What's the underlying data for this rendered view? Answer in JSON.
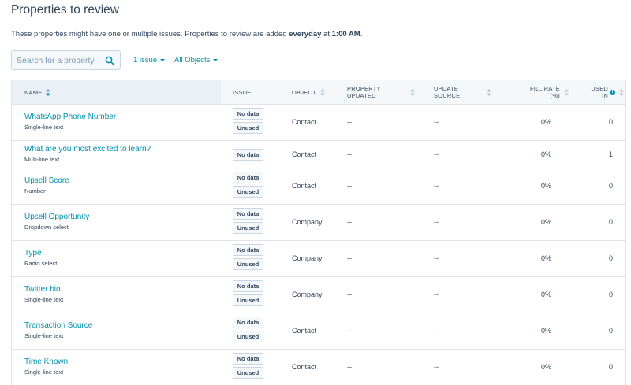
{
  "page": {
    "title": "Properties to review",
    "description_pre": "These properties might have one or multiple issues. Properties to review are added ",
    "description_bold1": "everyday",
    "description_mid": " at ",
    "description_bold2": "1:00 AM",
    "description_post": "."
  },
  "search": {
    "placeholder": "Search for a property",
    "value": ""
  },
  "filters": {
    "issue_label": "1 issue",
    "objects_label": "All Objects"
  },
  "table": {
    "headers": {
      "name": "NAME",
      "issue": "ISSUE",
      "object": "OBJECT",
      "property_updated_1": "PROPERTY",
      "property_updated_2": "UPDATED",
      "update_source_1": "UPDATE",
      "update_source_2": "SOURCE",
      "fill_rate_1": "FILL RATE",
      "fill_rate_2": "(%)",
      "used_in_1": "USED",
      "used_in_2": "IN"
    },
    "rows": [
      {
        "name": "WhatsApp Phone Number",
        "type": "Single-line text",
        "tags": [
          "No data",
          "Unused"
        ],
        "object": "Contact",
        "property_updated": "--",
        "update_source": "--",
        "fill_rate": "0%",
        "used_in": "0"
      },
      {
        "name": "What are you most excited to learn?",
        "type": "Multi-line text",
        "tags": [
          "No data"
        ],
        "object": "Contact",
        "property_updated": "--",
        "update_source": "--",
        "fill_rate": "0%",
        "used_in": "1"
      },
      {
        "name": "Upsell Score",
        "type": "Number",
        "tags": [
          "No data",
          "Unused"
        ],
        "object": "Contact",
        "property_updated": "--",
        "update_source": "--",
        "fill_rate": "0%",
        "used_in": "0"
      },
      {
        "name": "Upsell Opportunity",
        "type": "Dropdown select",
        "tags": [
          "No data",
          "Unused"
        ],
        "object": "Company",
        "property_updated": "--",
        "update_source": "--",
        "fill_rate": "0%",
        "used_in": "0"
      },
      {
        "name": "Type",
        "type": "Radio select",
        "tags": [
          "No data",
          "Unused"
        ],
        "object": "Company",
        "property_updated": "--",
        "update_source": "--",
        "fill_rate": "0%",
        "used_in": "0"
      },
      {
        "name": "Twitter bio",
        "type": "Single-line text",
        "tags": [
          "No data",
          "Unused"
        ],
        "object": "Company",
        "property_updated": "--",
        "update_source": "--",
        "fill_rate": "0%",
        "used_in": "0"
      },
      {
        "name": "Transaction Source",
        "type": "Single-line text",
        "tags": [
          "No data",
          "Unused"
        ],
        "object": "Contact",
        "property_updated": "--",
        "update_source": "--",
        "fill_rate": "0%",
        "used_in": "0"
      },
      {
        "name": "Time Known",
        "type": "Single-line text",
        "tags": [
          "No data",
          "Unused"
        ],
        "object": "Contact",
        "property_updated": "--",
        "update_source": "--",
        "fill_rate": "0%",
        "used_in": "0"
      }
    ]
  },
  "colors": {
    "link": "#0091ae",
    "text": "#33475b",
    "border": "#dfe3eb",
    "header_bg": "#f5f8fa"
  }
}
